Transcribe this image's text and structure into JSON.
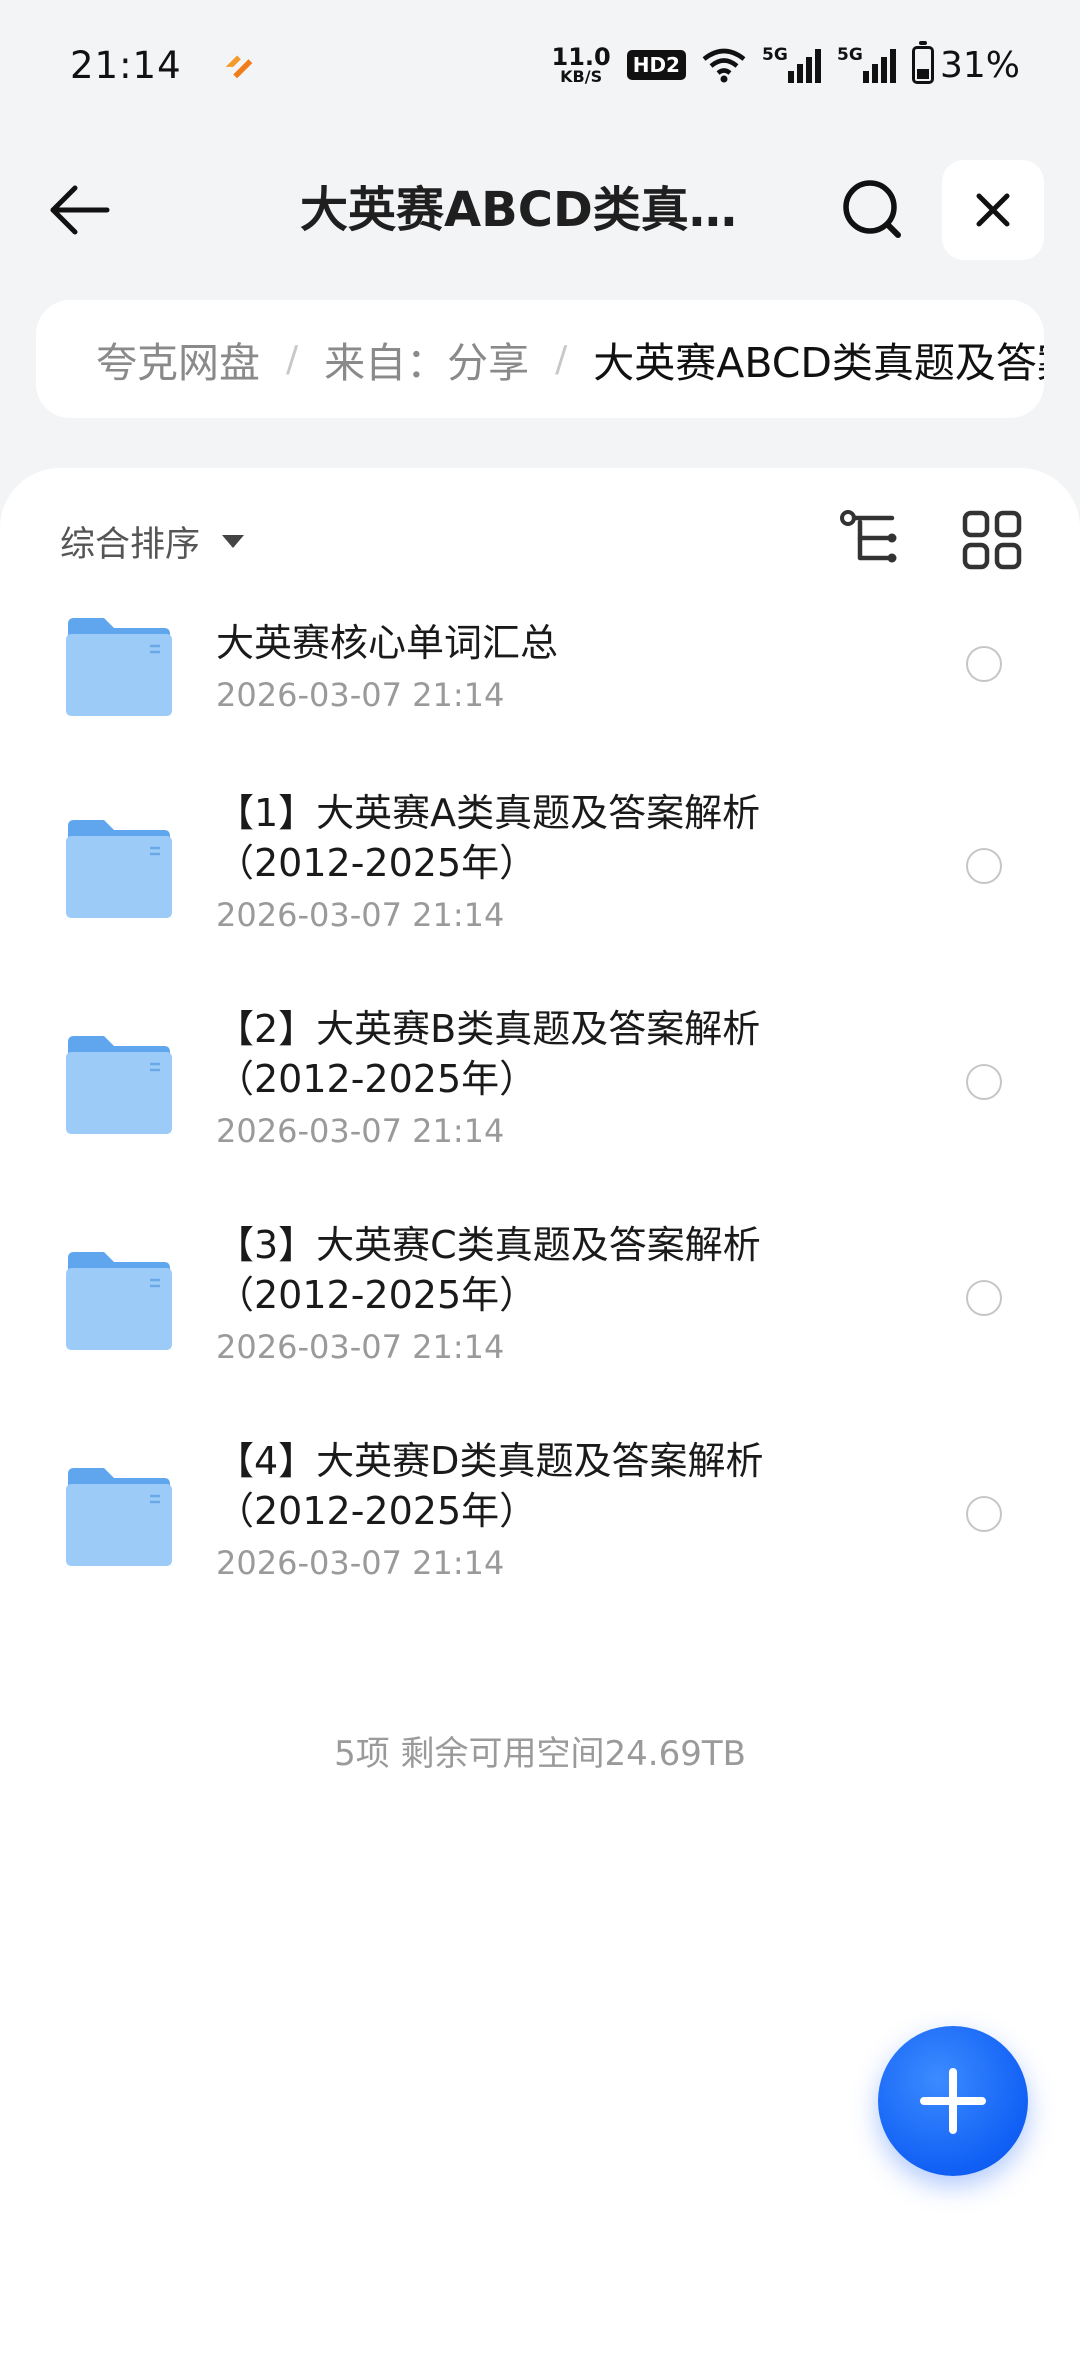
{
  "status_bar": {
    "time": "21:14",
    "net_speed_value": "11.0",
    "net_speed_unit": "KB/S",
    "hd_badge": "HD2",
    "signal_1_label": "5G",
    "signal_2_label": "5G",
    "battery": "31%"
  },
  "header": {
    "title": "大英赛ABCD类真题及答案解析"
  },
  "breadcrumb": {
    "items": [
      "夸克网盘",
      "来自：分享",
      "大英赛ABCD类真题及答案解析"
    ],
    "separator": "/"
  },
  "toolbar": {
    "sort_label": "综合排序"
  },
  "files": [
    {
      "name": "大英赛核心单词汇总",
      "date": "2026-03-07 21:14"
    },
    {
      "name": "【1】大英赛A类真题及答案解析（2012-2025年）",
      "date": "2026-03-07 21:14"
    },
    {
      "name": "【2】大英赛B类真题及答案解析（2012-2025年）",
      "date": "2026-03-07 21:14"
    },
    {
      "name": "【3】大英赛C类真题及答案解析（2012-2025年）",
      "date": "2026-03-07 21:14"
    },
    {
      "name": "【4】大英赛D类真题及答案解析（2012-2025年）",
      "date": "2026-03-07 21:14"
    }
  ],
  "footer": {
    "summary": "5项 剩余可用空间24.69TB"
  },
  "colors": {
    "accent": "#1160f5",
    "folder": "#6fb3f3",
    "background": "#f3f4f6"
  },
  "icons": [
    "back-arrow-icon",
    "search-icon",
    "close-icon",
    "tree-view-icon",
    "grid-view-icon",
    "folder-icon",
    "plus-icon",
    "wifi-icon",
    "battery-icon"
  ]
}
